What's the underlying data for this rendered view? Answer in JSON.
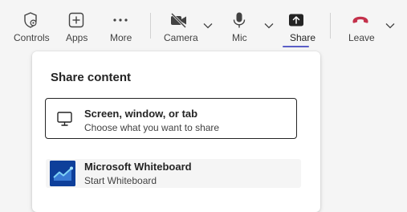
{
  "toolbar": {
    "controls_label": "Controls",
    "apps_label": "Apps",
    "more_label": "More",
    "camera_label": "Camera",
    "mic_label": "Mic",
    "share_label": "Share",
    "leave_label": "Leave"
  },
  "share_panel": {
    "title": "Share content",
    "options": [
      {
        "title": "Screen, window, or tab",
        "subtitle": "Choose what you want to share",
        "icon": "monitor-icon"
      },
      {
        "title": "Microsoft Whiteboard",
        "subtitle": "Start Whiteboard",
        "icon": "whiteboard-logo-icon"
      }
    ]
  },
  "colors": {
    "accent": "#5b5fc7",
    "leave_red": "#c4314b",
    "whiteboard_blue": "#0e3f9a"
  }
}
